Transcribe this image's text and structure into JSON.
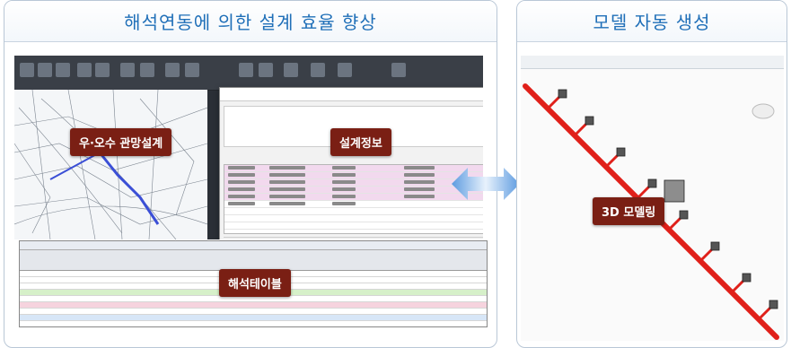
{
  "left_panel": {
    "title": "해석연동에 의한 설계 효율 향상",
    "labels": {
      "pipe_design": "우·오수 관망설계",
      "design_info": "설계정보",
      "analysis_table": "해석테이블"
    }
  },
  "right_panel": {
    "title": "모델 자동 생성",
    "labels": {
      "modeling": "3D 모델링"
    }
  },
  "colors": {
    "header_text": "#1f6fb8",
    "badge_bg": "#7a1f14",
    "pipe_red": "#e0201a",
    "arrow_blue": "#7fb2e6"
  }
}
